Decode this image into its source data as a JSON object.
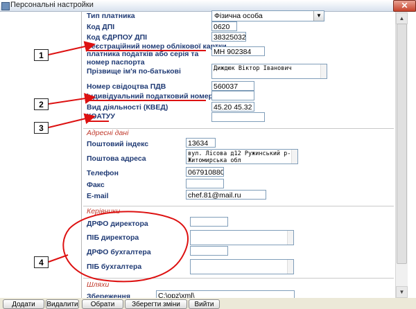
{
  "window": {
    "title": "Персональні настройки",
    "close_label": "✕"
  },
  "form": {
    "payer_type": {
      "label": "Тип платника",
      "value": "Фізична особа"
    },
    "dpi_code": {
      "label": "Код ДПІ",
      "value": "0620"
    },
    "edrpou_dpi": {
      "label": "Код ЄДРПОУ ДПІ",
      "value": "38325032"
    },
    "reg_card": {
      "label": "Реєстраційний номер облікової картки"
    },
    "passport": {
      "label": "платника податків або серія та номер паспорта",
      "value": "МН 902384"
    },
    "full_name": {
      "label": "Прізвище ім'я по-батькові",
      "value": "Диждюк Віктор Іванович"
    },
    "vat_cert": {
      "label": "Номер свідоцтва ПДВ",
      "value": "560037"
    },
    "tax_number": {
      "label": "Індивідуальний податковий номер",
      "value": ""
    },
    "activity": {
      "label": "Вид діяльності (КВЕД)",
      "value": "45.20  45.32"
    },
    "koatuu": {
      "label": "КОАТУУ",
      "value": ""
    }
  },
  "address": {
    "section_title": "Адресні дані",
    "postal_index": {
      "label": "Поштовий індекс",
      "value": "13634"
    },
    "postal_address": {
      "label": "Поштова адреса",
      "value": "вул. Лісова д12 Ружинський р-н Житомирська обл"
    },
    "phone": {
      "label": "Телефон",
      "value": "0679108805"
    },
    "fax": {
      "label": "Факс",
      "value": ""
    },
    "email": {
      "label": "E-mail",
      "value": "chef.81@mail.ru"
    }
  },
  "managers": {
    "section_title": "Керівники",
    "drfo_director": {
      "label": "ДРФО директора",
      "value": ""
    },
    "pib_director": {
      "label": "ПІБ директора",
      "value": ""
    },
    "drfo_accountant": {
      "label": "ДРФО бухгалтера",
      "value": ""
    },
    "pib_accountant": {
      "label": "ПІБ бухгалтера",
      "value": ""
    }
  },
  "paths": {
    "section_title": "Шляхи",
    "save": {
      "label": "Збереження",
      "value": "C:\\opz\\xml\\"
    }
  },
  "annotations": {
    "n1": "1",
    "n2": "2",
    "n3": "3",
    "n4": "4"
  },
  "bottom_buttons": {
    "b1": "Додати",
    "b2": "Видалити",
    "b3": "Обрати",
    "b4": "Зберегти зміни",
    "b5": "Вийти"
  },
  "colors": {
    "label": "#1f3a74",
    "section": "#c0392b",
    "annotation": "#dd1111"
  },
  "icons": {
    "close": "close-icon",
    "dropdown": "chevron-down-icon"
  }
}
